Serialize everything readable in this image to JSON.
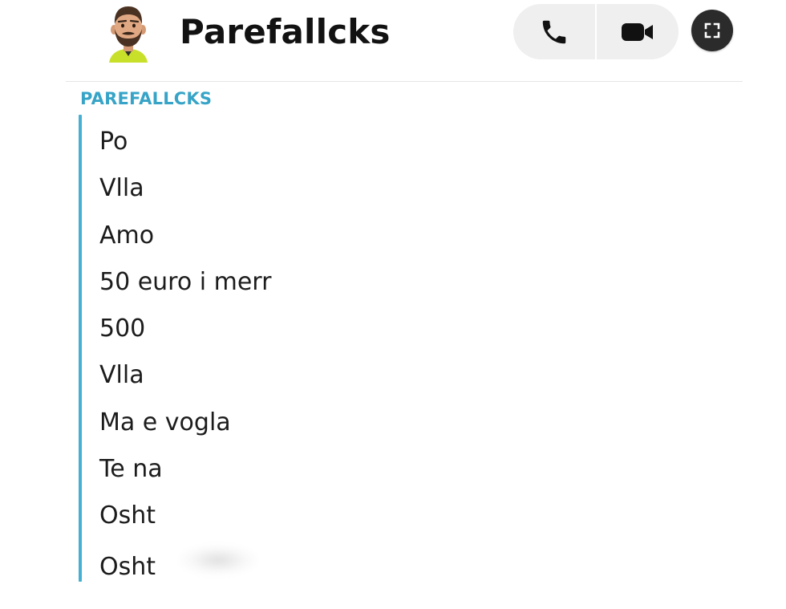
{
  "header": {
    "contact_name": "Parefallcks",
    "avatar_icon": "bitmoji-avatar",
    "phone_icon": "phone-icon",
    "video_icon": "video-camera-icon",
    "expand_icon": "expand-icon"
  },
  "chat": {
    "sender_label": "PAREFALLCKS",
    "accent_color": "#45afd4",
    "messages": [
      "Po",
      "Vlla",
      "Amo",
      "50 euro i merr",
      "500",
      "Vlla",
      "Ma e vogla",
      "Te na",
      "Osht",
      "Osht"
    ]
  }
}
